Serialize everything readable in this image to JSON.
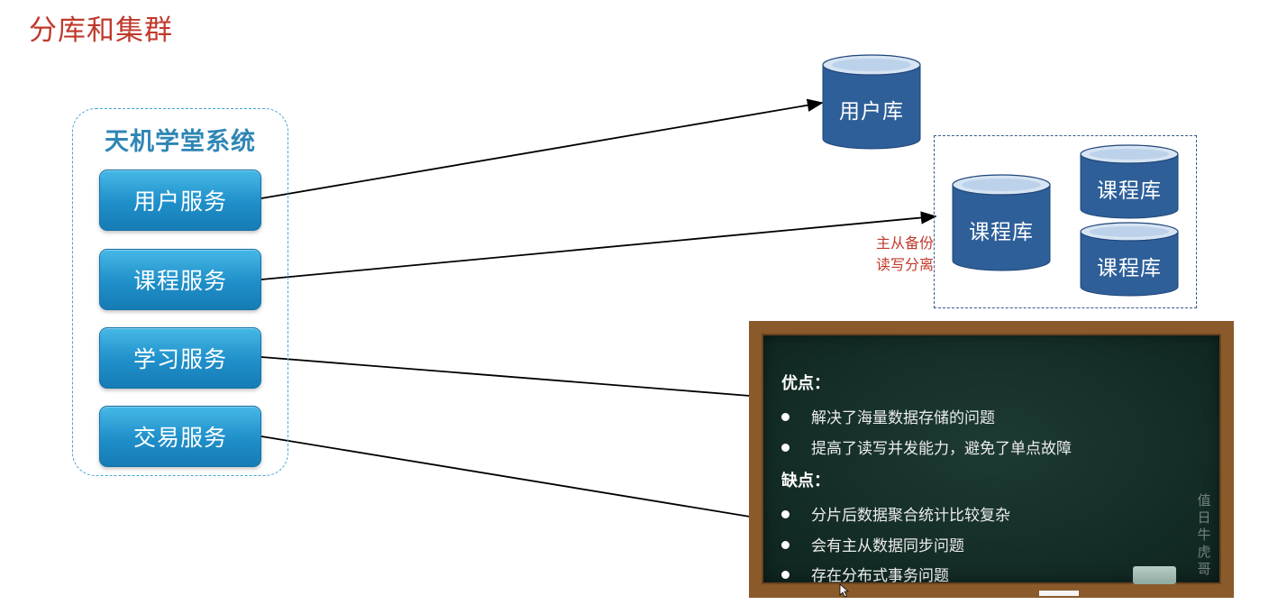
{
  "slide": {
    "title": "分库和集群"
  },
  "system": {
    "title": "天机学堂系统",
    "services": [
      {
        "id": "user",
        "label": "用户服务"
      },
      {
        "id": "course",
        "label": "课程服务"
      },
      {
        "id": "learning",
        "label": "学习服务"
      },
      {
        "id": "trade",
        "label": "交易服务"
      }
    ]
  },
  "databases": {
    "user_db": "用户库",
    "course_master": "课程库",
    "course_replica_1": "课程库",
    "course_replica_2": "课程库"
  },
  "cluster_note": {
    "line1": "主从备份",
    "line2": "读写分离"
  },
  "board": {
    "pros_title": "优点：",
    "pros": [
      "解决了海量数据存储的问题",
      "提高了读写并发能力，避免了单点故障"
    ],
    "cons_title": "缺点：",
    "cons": [
      "分片后数据聚合统计比较复杂",
      "会有主从数据同步问题",
      "存在分布式事务问题"
    ],
    "watermark": [
      "值",
      "日",
      "牛",
      "虎",
      "哥"
    ]
  },
  "colors": {
    "title_red": "#c0392b",
    "service_blue": "#1f8fc9",
    "db_blue": "#2e5f99",
    "board_green": "#163029",
    "board_frame": "#8a5a2b"
  }
}
